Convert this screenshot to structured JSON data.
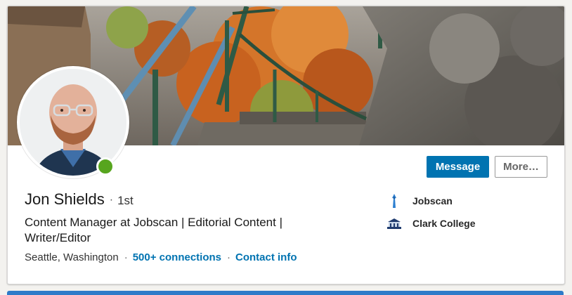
{
  "profile": {
    "name": "Jon Shields",
    "separator": "·",
    "degree": "1st",
    "headline": "Content Manager at Jobscan | Editorial Content | Writer/Editor",
    "location": "Seattle, Washington",
    "connections": "500+ connections",
    "contact_info": "Contact info",
    "online": true
  },
  "actions": {
    "message_label": "Message",
    "more_label": "More…"
  },
  "experience": [
    {
      "label": "Jobscan",
      "icon": "jobscan-logo-icon"
    },
    {
      "label": "Clark College",
      "icon": "clark-college-logo-icon"
    }
  ],
  "colors": {
    "primary": "#0073b1",
    "presence": "#57a51e",
    "link": "#0073b1"
  }
}
